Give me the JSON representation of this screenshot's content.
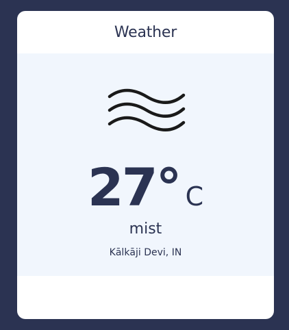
{
  "card": {
    "title": "Weather"
  },
  "weather": {
    "icon": "mist-icon",
    "temperature": "27°",
    "unit": "C",
    "condition": "mist",
    "location": "Kālkāji Devi, IN"
  },
  "colors": {
    "background": "#2b3352",
    "card": "#ffffff",
    "panel": "#f1f6fd",
    "text": "#2b3352"
  }
}
